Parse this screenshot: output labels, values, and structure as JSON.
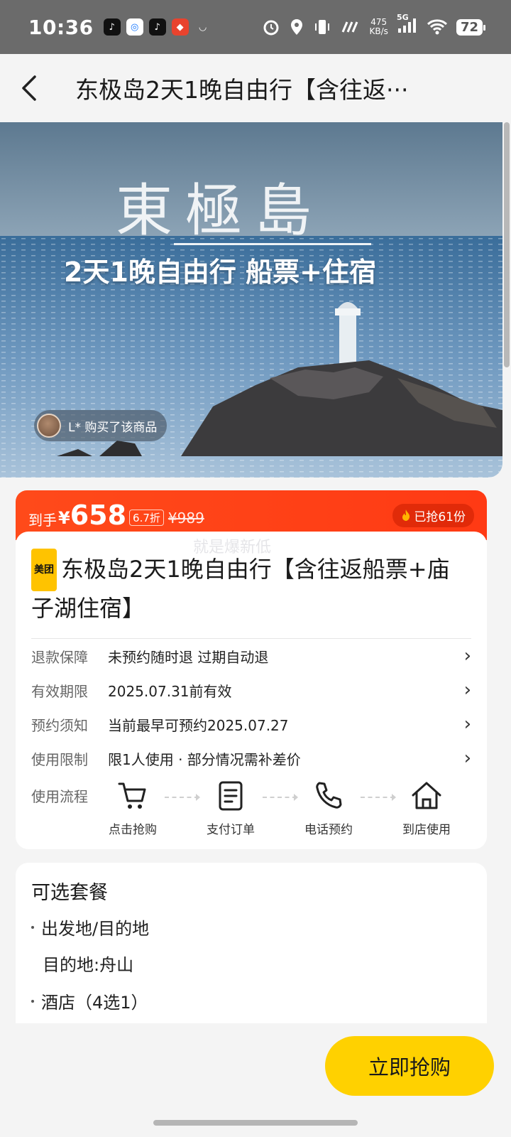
{
  "status_bar": {
    "time": "10:36",
    "net_speed_value": "475",
    "net_speed_unit": "KB/s",
    "network": "5G",
    "battery": "72"
  },
  "nav": {
    "title": "东极岛2天1晚自由行【含往返···"
  },
  "hero": {
    "title": "東極島",
    "subtitle": "2天1晚自由行 船票+住宿",
    "buyer_text": "L* 购买了该商品"
  },
  "price": {
    "label": "到手",
    "currency": "¥",
    "value": "658",
    "discount": "6.7折",
    "original": "¥989",
    "sold": "已抢61份"
  },
  "product": {
    "watermark": "就是爆新低",
    "brand": "美团",
    "title": "东极岛2天1晚自由行【含往返船票+庙子湖住宿】",
    "rows": [
      {
        "key": "退款保障",
        "value": "未预约随时退 过期自动退"
      },
      {
        "key": "有效期限",
        "value": "2025.07.31前有效"
      },
      {
        "key": "预约须知",
        "value": "当前最早可预约2025.07.27"
      },
      {
        "key": "使用限制",
        "value": "限1人使用 · 部分情况需补差价"
      }
    ],
    "flow_label": "使用流程",
    "steps": [
      {
        "label": "点击抢购",
        "icon": "cart-icon"
      },
      {
        "label": "支付订单",
        "icon": "document-icon"
      },
      {
        "label": "电话预约",
        "icon": "phone-icon"
      },
      {
        "label": "到店使用",
        "icon": "home-icon"
      }
    ]
  },
  "packages": {
    "title": "可选套餐",
    "item1": "出发地/目的地",
    "item1_sub": "目的地:舟山",
    "item2": "酒店（4选1）"
  },
  "cta": {
    "buy_label": "立即抢购"
  },
  "colors": {
    "price_bar": "#ff3a14",
    "cta": "#ffd100",
    "brand": "#ffc300"
  }
}
